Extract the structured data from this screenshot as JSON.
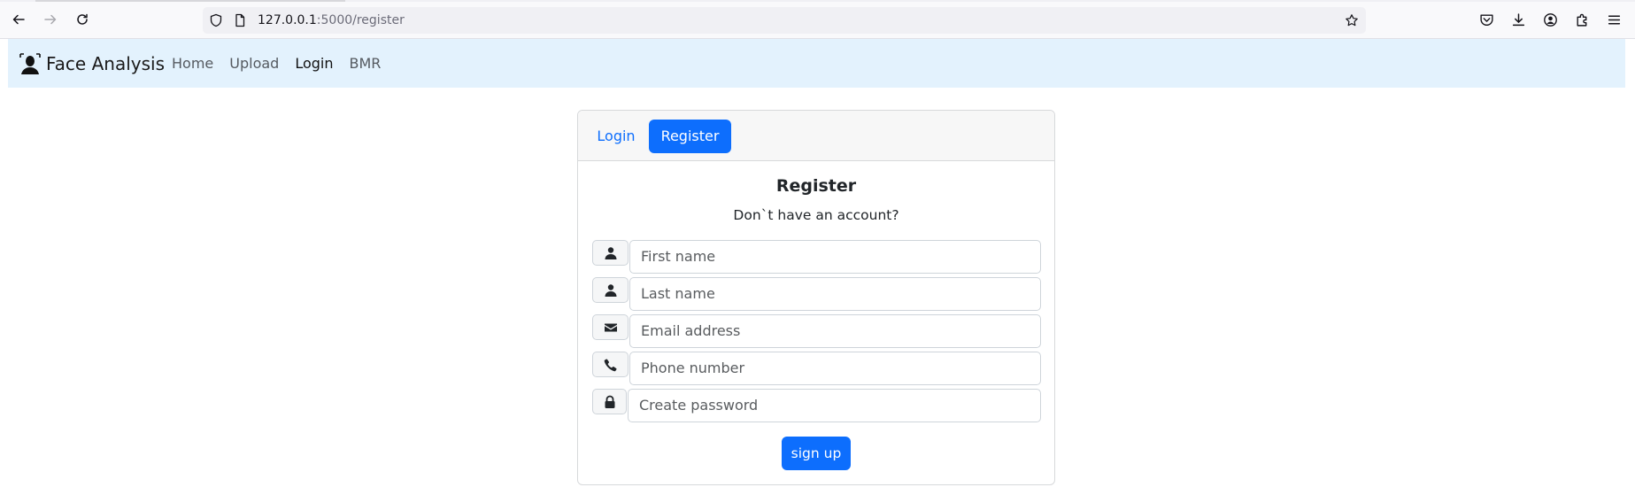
{
  "browser": {
    "url_host": "127.0.0.1",
    "url_rest": ":5000/register"
  },
  "navbar": {
    "brand": "Face Analysis",
    "links": [
      "Home",
      "Upload",
      "Login",
      "BMR"
    ],
    "active_link": "Login"
  },
  "card": {
    "tabs": {
      "login": "Login",
      "register": "Register"
    },
    "active_tab": "Register",
    "title": "Register",
    "subtitle": "Don`t have an account?",
    "fields": [
      {
        "icon": "user-icon",
        "placeholder": "First name"
      },
      {
        "icon": "user-icon",
        "placeholder": "Last name"
      },
      {
        "icon": "envelope-icon",
        "placeholder": "Email address"
      },
      {
        "icon": "phone-icon",
        "placeholder": "Phone number"
      },
      {
        "icon": "lock-icon",
        "placeholder": "Create password"
      }
    ],
    "submit_label": "sign up"
  },
  "colors": {
    "primary": "#0d6efd",
    "navbar_bg": "#e3f2fd"
  }
}
